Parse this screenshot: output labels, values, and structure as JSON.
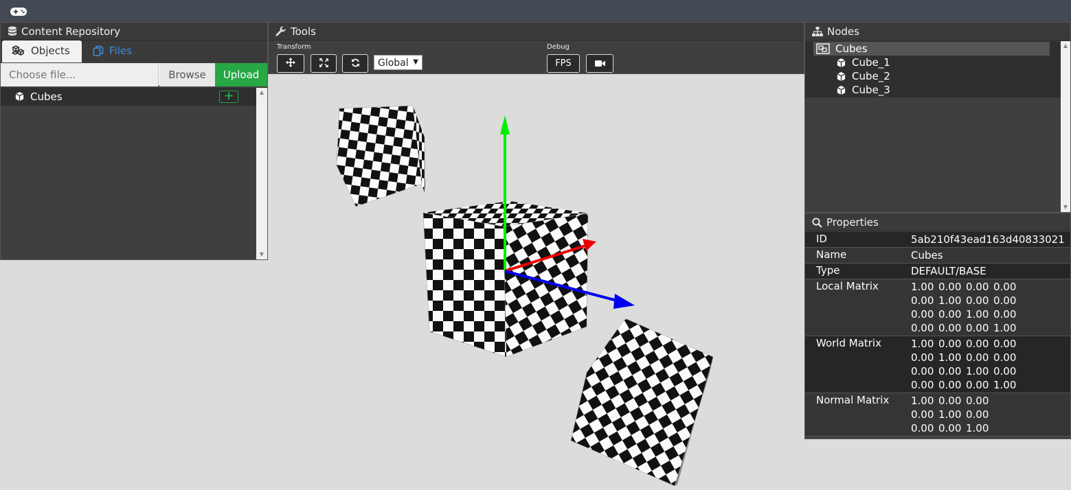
{
  "app": {
    "logo": "gamepad-icon"
  },
  "repository": {
    "title": "Content Repository",
    "tabs": [
      {
        "label": "Objects",
        "icon": "cubes-icon",
        "active": true
      },
      {
        "label": "Files",
        "icon": "files-icon",
        "active": false
      }
    ],
    "file_placeholder": "Choose file...",
    "browse_label": "Browse",
    "upload_label": "Upload",
    "items": [
      {
        "label": "Cubes",
        "icon": "cube-icon",
        "add": "+"
      }
    ]
  },
  "tools": {
    "title": "Tools",
    "groups": {
      "transform": "Transform",
      "debug": "Debug"
    },
    "transform_buttons": [
      "move-icon",
      "scale-icon",
      "rotate-icon"
    ],
    "space_value": "Global",
    "debug_buttons": {
      "fps": "FPS",
      "camera": "video-camera-icon"
    }
  },
  "nodes": {
    "title": "Nodes",
    "tree": [
      {
        "label": "Cubes",
        "icon": "group-icon",
        "selected": true,
        "children": [
          {
            "label": "Cube_1",
            "icon": "cube-icon"
          },
          {
            "label": "Cube_2",
            "icon": "cube-icon"
          },
          {
            "label": "Cube_3",
            "icon": "cube-icon"
          }
        ]
      }
    ]
  },
  "properties": {
    "title": "Properties",
    "rows": [
      {
        "key": "ID",
        "value": "5ab210f43ead163d40833021"
      },
      {
        "key": "Name",
        "value": "Cubes"
      },
      {
        "key": "Type",
        "value": "DEFAULT/BASE"
      },
      {
        "key": "Local Matrix",
        "matrix": [
          [
            "1.00",
            "0.00",
            "0.00",
            "0.00"
          ],
          [
            "0.00",
            "1.00",
            "0.00",
            "0.00"
          ],
          [
            "0.00",
            "0.00",
            "1.00",
            "0.00"
          ],
          [
            "0.00",
            "0.00",
            "0.00",
            "1.00"
          ]
        ]
      },
      {
        "key": "World Matrix",
        "matrix": [
          [
            "1.00",
            "0.00",
            "0.00",
            "0.00"
          ],
          [
            "0.00",
            "1.00",
            "0.00",
            "0.00"
          ],
          [
            "0.00",
            "0.00",
            "1.00",
            "0.00"
          ],
          [
            "0.00",
            "0.00",
            "0.00",
            "1.00"
          ]
        ]
      },
      {
        "key": "Normal Matrix",
        "matrix": [
          [
            "1.00",
            "0.00",
            "0.00"
          ],
          [
            "0.00",
            "1.00",
            "0.00"
          ],
          [
            "0.00",
            "0.00",
            "1.00"
          ]
        ]
      }
    ]
  },
  "viewport": {
    "background": "#dcdcdc",
    "gizmo_colors": {
      "x": "#ff0000",
      "y": "#00ee00",
      "z": "#0000ee"
    },
    "objects": [
      "checker-cube",
      "checker-cube",
      "checker-cube"
    ]
  }
}
